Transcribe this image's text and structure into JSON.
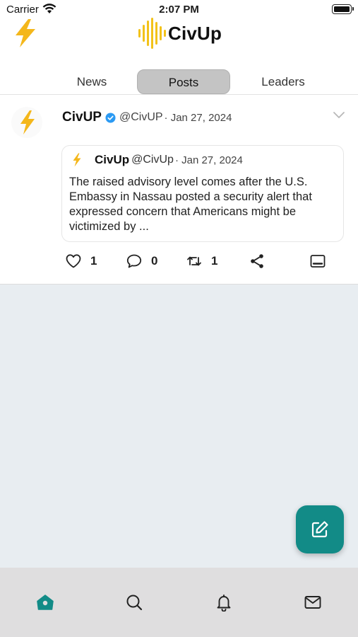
{
  "status_bar": {
    "carrier": "Carrier",
    "time": "2:07 PM"
  },
  "header": {
    "app_name": "CivUp",
    "brand_color": "#f2c21a",
    "bolt_color": "#f4b71b"
  },
  "tabs": [
    {
      "label": "News",
      "selected": false
    },
    {
      "label": "Posts",
      "selected": true
    },
    {
      "label": "Leaders",
      "selected": false
    }
  ],
  "post": {
    "author": "CivUP",
    "verified": true,
    "handle": "@CivUP",
    "date": "· Jan 27, 2024",
    "quote": {
      "author": "CivUp",
      "handle": "@CivUp",
      "date": "· Jan 27, 2024",
      "text": "The raised advisory level comes after the U.S. Embassy in Nassau posted a security alert that expressed concern that Americans might be victimized by  ..."
    },
    "actions": {
      "likes": "1",
      "comments": "0",
      "reposts": "1"
    }
  },
  "fab": {
    "icon": "compose-icon",
    "color": "#128b87"
  },
  "bottom_nav": [
    {
      "icon": "home-icon",
      "active": true
    },
    {
      "icon": "search-icon",
      "active": false
    },
    {
      "icon": "bell-icon",
      "active": false
    },
    {
      "icon": "mail-icon",
      "active": false
    }
  ],
  "colors": {
    "accent": "#128b87",
    "verified": "#2b9af3",
    "feed_background": "#e8edf1"
  }
}
